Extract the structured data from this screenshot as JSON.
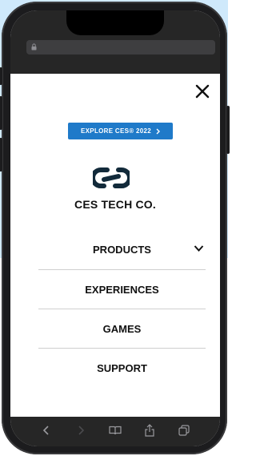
{
  "menu": {
    "explore_cta": "EXPLORE CES® 2022",
    "brand": "CES TECH CO.",
    "items": [
      {
        "label": "PRODUCTS",
        "expandable": true
      },
      {
        "label": "EXPERIENCES"
      },
      {
        "label": "GAMES"
      },
      {
        "label": "SUPPORT"
      }
    ]
  },
  "icons": {
    "close": "close-icon",
    "lock": "lock-icon",
    "logo": "chain-link-logo",
    "chevron": "chevron-down-icon",
    "back": "back-arrow-icon",
    "forward": "forward-arrow-icon",
    "bookmarks": "book-icon",
    "share": "share-icon",
    "tabs": "tabs-icon"
  },
  "colors": {
    "accent": "#1f7ac9",
    "background_panel": "#cfe9fb",
    "browser_chrome": "#262626"
  }
}
